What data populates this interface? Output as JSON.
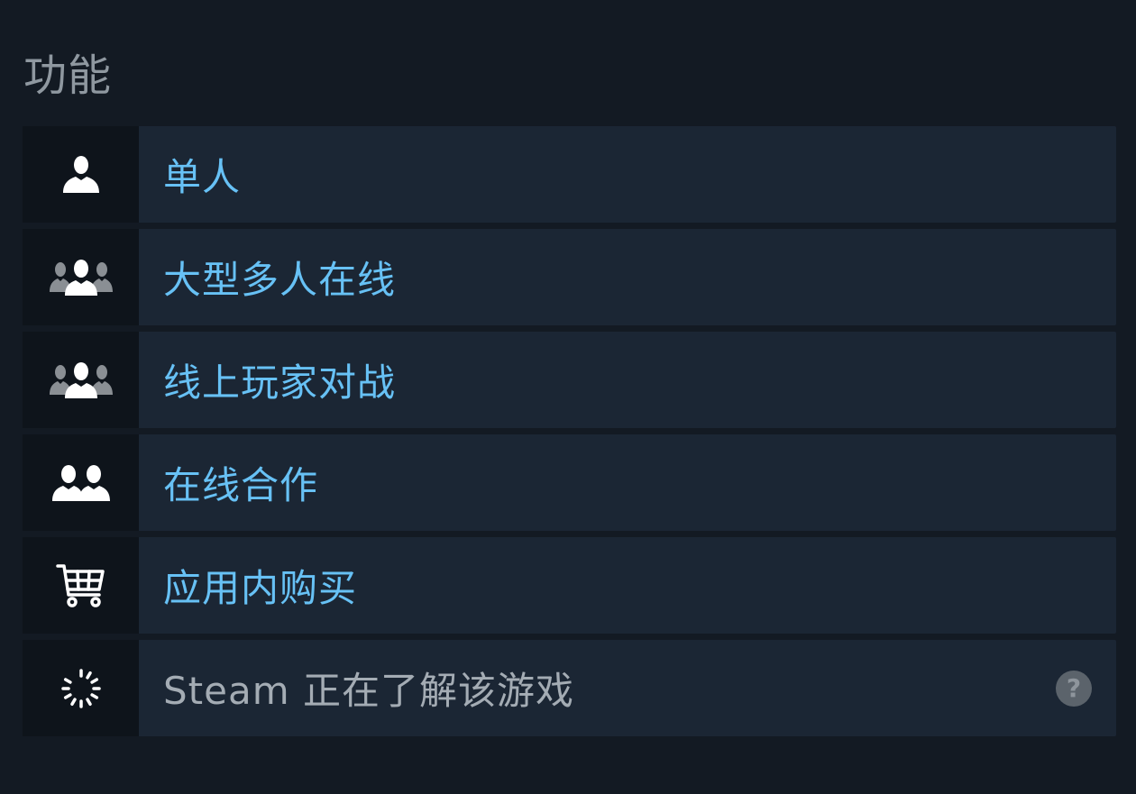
{
  "section": {
    "title": "功能"
  },
  "features": [
    {
      "label": "单人",
      "icon": "single-person-icon",
      "style": "link"
    },
    {
      "label": "大型多人在线",
      "icon": "mmo-people-icon",
      "style": "link"
    },
    {
      "label": "线上玩家对战",
      "icon": "pvp-people-icon",
      "style": "link"
    },
    {
      "label": "在线合作",
      "icon": "coop-people-icon",
      "style": "link"
    },
    {
      "label": "应用内购买",
      "icon": "shopping-cart-icon",
      "style": "link"
    },
    {
      "label": "Steam 正在了解该游戏",
      "icon": "loading-spinner-icon",
      "style": "muted",
      "help": "?"
    }
  ],
  "colors": {
    "background": "#131a23",
    "row_background": "#1b2634",
    "icon_background": "#0e141b",
    "link_text": "#67c1f5",
    "muted_text": "#a4acb4",
    "title_text": "#8f98a0"
  }
}
